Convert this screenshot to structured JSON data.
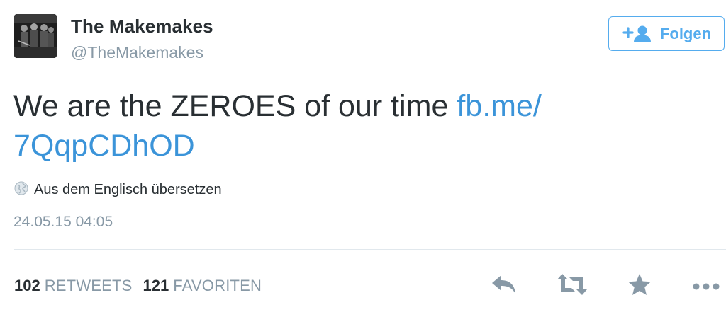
{
  "user": {
    "display_name": "The Makemakes",
    "screen_name": "@TheMakemakes"
  },
  "follow_button": {
    "label": "Folgen"
  },
  "tweet": {
    "text": "We are the ZEROES of our time ",
    "link_part1": "fb.me/",
    "link_part2": "7QqpCDhOD"
  },
  "translate": {
    "label": "Aus dem Englisch übersetzen"
  },
  "timestamp": "24.05.15 04:05",
  "stats": {
    "retweets_count": "102",
    "retweets_label": "RETWEETS",
    "favorites_count": "121",
    "favorites_label": "FAVORITEN"
  },
  "colors": {
    "accent": "#55acee",
    "link": "#3b94d9",
    "muted": "#8899a6",
    "text": "#292f33",
    "icon": "#8899a6"
  },
  "icons": [
    "globe-icon",
    "follow-person-icon",
    "reply-icon",
    "retweet-icon",
    "star-icon",
    "more-icon"
  ]
}
